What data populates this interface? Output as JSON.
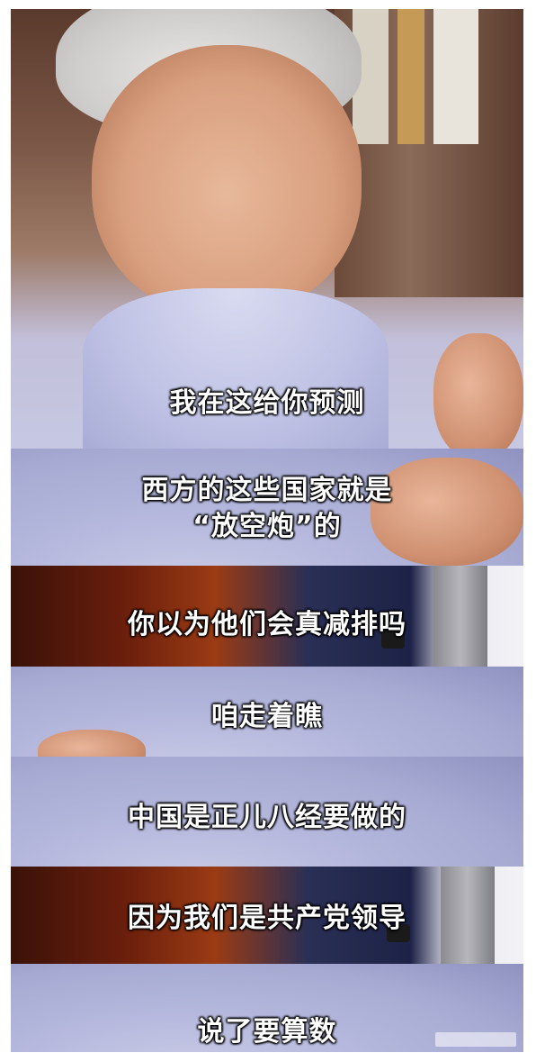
{
  "subtitles": {
    "p1": "我在这给你预测",
    "p2_line1": "西方的这些国家就是",
    "p2_line2": "“放空炮”的",
    "p3": "你以为他们会真减排吗",
    "p4": "咱走着瞧",
    "p5": "中国是正儿八经要做的",
    "p6": "因为我们是共产党领导",
    "p7": "说了要算数"
  },
  "colors": {
    "shirt": "#b4b7dc",
    "suit": "#1d2247",
    "studio_red": "#9a3b14",
    "subtitle_text": "#ffffff"
  }
}
